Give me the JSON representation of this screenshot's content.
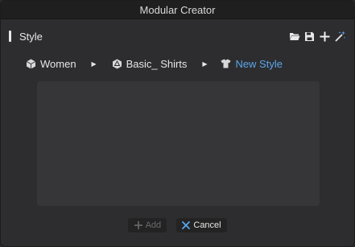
{
  "window": {
    "title": "Modular Creator"
  },
  "section": {
    "title": "Style"
  },
  "toolbar": {
    "buttons": [
      {
        "icon": "folder-open-icon"
      },
      {
        "icon": "save-icon"
      },
      {
        "icon": "plus-icon"
      },
      {
        "icon": "magic-wand-icon"
      }
    ]
  },
  "breadcrumb": {
    "items": [
      {
        "label": "Women",
        "icon": "hexagon-cube-icon"
      },
      {
        "label": "Basic_ Shirts",
        "icon": "hexagon-cube-icon"
      },
      {
        "label": "New Style",
        "icon": "shirt-icon"
      }
    ],
    "active_color": "#5aa6ea"
  },
  "footer": {
    "add_label": "Add",
    "cancel_label": "Cancel"
  },
  "colors": {
    "background": "#2d2d2f",
    "panel": "#363638",
    "titlebar": "#1f1f20",
    "accent": "#5aa6ea",
    "cancel_icon": "#5aa6ea"
  }
}
